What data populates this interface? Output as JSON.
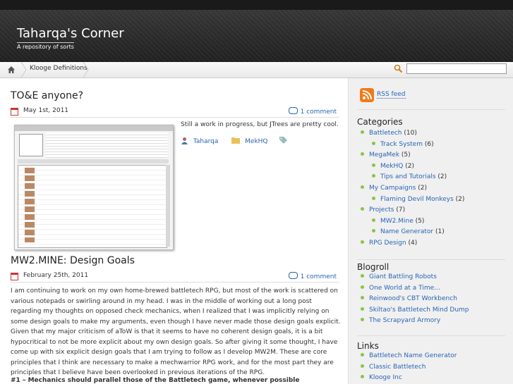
{
  "site": {
    "title": "Taharqa's Corner",
    "description": "A repository of sorts"
  },
  "nav": {
    "item": "Kloogе Definitions",
    "search_placeholder": ""
  },
  "posts": [
    {
      "title": "TO&E anyone?",
      "date": "May 1st, 2011",
      "comments": "1 comment",
      "excerpt": "Still a work in progress, but JTrees are pretty cool.",
      "author": "Taharqa",
      "category": "MekHQ"
    },
    {
      "title": "MW2.MINE: Design Goals",
      "date": "February 25th, 2011",
      "comments": "1 comment",
      "body": "I am continuing to work on my own home-brewed battletech RPG, but most of the work is scattered on various notepads or swirling around in my head. I was in the middle of working out a long post regarding my thoughts on opposed check mechanics, when I realized that I was implicitly relying on some design goals to make my arguments, even though I have never made those design goals explicit. Given that my major criticism of aToW is that it seems to have no coherent design goals, it is a bit hypocritical to not be more explicit about my own design goals. So after giving it some thought, I have come up with six explicit design goals that I am trying to follow as I develop MW2M. These are core principles that I think are necessary to make a mechwarrior RPG work, and for the most part they are principles that I believe have been overlooked in previous iterations of the RPG.",
      "subhead": "#1 – Mechanics should parallel those of the Battletech game, whenever possible"
    }
  ],
  "sidebar": {
    "rss": "RSS feed",
    "categories_title": "Categories",
    "categories": [
      {
        "label": "Battletech",
        "count": "(10)",
        "level": 0
      },
      {
        "label": "Track System",
        "count": "(6)",
        "level": 1
      },
      {
        "label": "MegaMek",
        "count": "(5)",
        "level": 0
      },
      {
        "label": "MekHQ",
        "count": "(2)",
        "level": 1
      },
      {
        "label": "Tips and Tutorials",
        "count": "(2)",
        "level": 1
      },
      {
        "label": "My Campaigns",
        "count": "(2)",
        "level": 0
      },
      {
        "label": "Flaming Devil Monkeys",
        "count": "(2)",
        "level": 1
      },
      {
        "label": "Projects",
        "count": "(7)",
        "level": 0
      },
      {
        "label": "MW2.Mine",
        "count": "(5)",
        "level": 1
      },
      {
        "label": "Name Generator",
        "count": "(1)",
        "level": 1
      },
      {
        "label": "RPG Design",
        "count": "(4)",
        "level": 0
      }
    ],
    "blogroll_title": "Blogroll",
    "blogroll": [
      "Giant Battling Robots",
      "One World at a Time…",
      "Reinwood's CBT Workbench",
      "Skiltao's Battletech Mind Dump",
      "The Scrapyard Armory"
    ],
    "links_title": "Links",
    "links": [
      "Battletech Name Generator",
      "Classic Battletech",
      "Klooge Inc"
    ]
  }
}
